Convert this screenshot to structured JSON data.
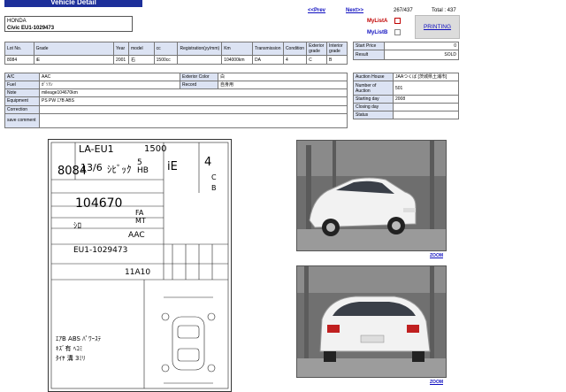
{
  "page": {
    "title": "Vehicle Detail"
  },
  "vehicle": {
    "make": "HONDA",
    "model_line": "Civic EU1-1029473"
  },
  "nav": {
    "prev": "<<Prev",
    "next": "Next>>",
    "position": "267/437",
    "total": "Total : 437"
  },
  "mylist": {
    "a": "MyListA",
    "b": "MyListB"
  },
  "print_button": "PRINTING",
  "spec_table": {
    "headers": [
      "Lot No.",
      "Grade",
      "Year",
      "model",
      "cc",
      "Registration(yy/mm)",
      "Km",
      "Transmission",
      "Condition",
      "Exterior grade",
      "Interior grade"
    ],
    "values": [
      "8084",
      "iE",
      "2001",
      "右",
      "1500cc",
      "",
      "104000km",
      "DA",
      "4",
      "C",
      "B"
    ]
  },
  "price_table": {
    "start_price_label": "Start Price",
    "start_price": "0",
    "result_label": "Result",
    "result": "SOLD"
  },
  "features_table": {
    "ac_label": "A/C",
    "ac": "AAC",
    "exterior_color_label": "Exterior Color",
    "exterior_color": "白",
    "fuel_label": "Fuel",
    "fuel": "ｶﾞｿﾘﾝ",
    "record_label": "Record",
    "record": "自身用",
    "note_label": "Note",
    "note": "mileage104670km",
    "equipment_label": "Equipment",
    "equipment": "PS PW ｴｱB ABS",
    "correction_label": "Correction",
    "correction": "",
    "save_comment_label": "save comment",
    "save_comment": ""
  },
  "auction_table": {
    "house_label": "Auction House",
    "house": "JAAつくば [茨城県土浦市]",
    "number_label": "Number of Auction",
    "number": "501",
    "starting_label": "Starting day",
    "starting": "2008",
    "closing_label": "Closing day",
    "closing": "",
    "status_label": "Status",
    "status": ""
  },
  "sheet": {
    "lot": "8084",
    "year": "13/6",
    "model_code": "LA-EU1",
    "cc": "1500",
    "make": "ｼﾋﾞｯｸ",
    "grade": "iE",
    "doors": "5 HB",
    "score": "4",
    "ext": "C",
    "int": "B",
    "km": "104670",
    "color": "ｼﾛ",
    "trans": "FA MT",
    "ac": "AAC",
    "chassis": "EU1-1029473",
    "cells": "11A10",
    "notes": [
      "ｴｱB ABS ﾊﾟﾜｰｽﾃ",
      "ｷｽﾞ有 ﾍｺﾐ",
      "ﾀｲﾔ 溝 3ﾐﾘ"
    ]
  },
  "zoom": {
    "label": "ZOOM"
  },
  "colors": {
    "header_blue": "#1d2f9a",
    "label_bg": "#dce3f3",
    "link": "#1010c0",
    "red": "#c00000"
  }
}
